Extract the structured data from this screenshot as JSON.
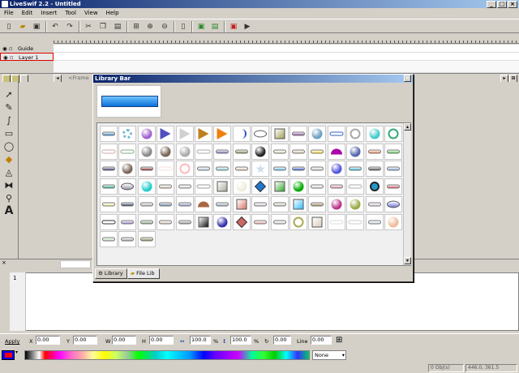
{
  "window": {
    "title": "LiveSwif 2.2 - Untitled"
  },
  "menu": [
    "File",
    "Edit",
    "Insert",
    "Tool",
    "View",
    "Help"
  ],
  "timeline": {
    "layers": [
      {
        "name": "Guide"
      },
      {
        "name": "Layer 1"
      }
    ],
    "frame_tab": "<Frame"
  },
  "library": {
    "title": "Library Bar",
    "tabs": [
      {
        "label": "Library",
        "icon": "gear-icon"
      },
      {
        "label": "File Lib",
        "icon": "folder-icon"
      }
    ]
  },
  "code": {
    "line_number": "1"
  },
  "properties": {
    "apply_label": "Apply",
    "x_label": "X",
    "x_value": "0.00",
    "y_label": "Y",
    "y_value": "0.00",
    "w_label": "W",
    "w_value": "0.00",
    "h_label": "H",
    "h_value": "0.00",
    "scale_w_value": "100.0",
    "pct1": "%",
    "scale_h_value": "100.0",
    "pct2": "%",
    "rotate_value": "0.00",
    "line_label": "Line",
    "line_value": "0.00"
  },
  "color": {
    "fill_option": "None",
    "stroke_color": "#0000ff",
    "fill_color": "#ff0000"
  },
  "status": {
    "objects": "0 Obj(s)",
    "coords": "446.0, 361.5"
  }
}
